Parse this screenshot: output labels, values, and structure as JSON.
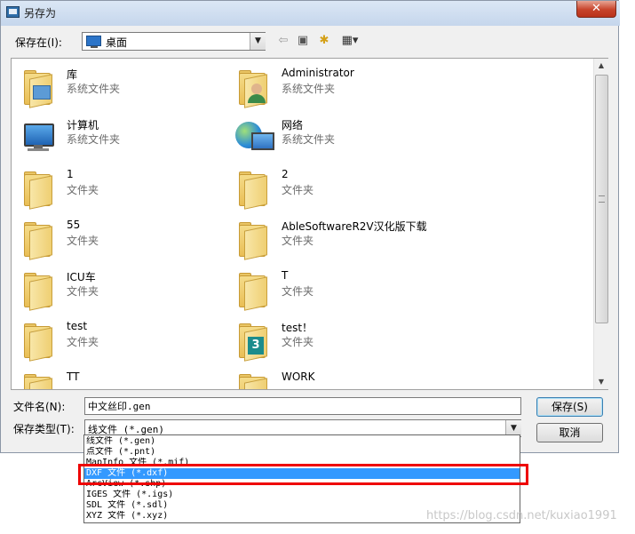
{
  "window": {
    "title": "另存为",
    "close_label": "✕"
  },
  "savein": {
    "label": "保存在(I):",
    "value": "桌面"
  },
  "toolbar": {
    "back": "⇦",
    "up": "▣",
    "new_folder": "✱",
    "view": "▦▾"
  },
  "files": [
    {
      "name": "库",
      "sub": "系统文件夹",
      "icon": "library-icon"
    },
    {
      "name": "Administrator",
      "sub": "系统文件夹",
      "icon": "user-folder-icon"
    },
    {
      "name": "计算机",
      "sub": "系统文件夹",
      "icon": "computer-icon"
    },
    {
      "name": "网络",
      "sub": "系统文件夹",
      "icon": "network-icon"
    },
    {
      "name": "1",
      "sub": "文件夹",
      "icon": "folder-icon"
    },
    {
      "name": "2",
      "sub": "文件夹",
      "icon": "folder-icon"
    },
    {
      "name": "55",
      "sub": "文件夹",
      "icon": "folder-icon"
    },
    {
      "name": "AbleSoftwareR2V汉化版下载",
      "sub": "文件夹",
      "icon": "folder-icon"
    },
    {
      "name": "ICU车",
      "sub": "文件夹",
      "icon": "folder-icon"
    },
    {
      "name": "T",
      "sub": "文件夹",
      "icon": "folder-icon"
    },
    {
      "name": "test",
      "sub": "文件夹",
      "icon": "folder-icon"
    },
    {
      "name": "test！",
      "sub": "文件夹",
      "icon": "folder-3dsmax-icon"
    },
    {
      "name": "TT",
      "sub": "",
      "icon": "folder-icon"
    },
    {
      "name": "WORK",
      "sub": "",
      "icon": "folder-icon"
    }
  ],
  "filename": {
    "label": "文件名(N):",
    "value": "中文丝印.gen"
  },
  "filetype": {
    "label": "保存类型(T):",
    "value": "线文件 (*.gen)",
    "options": [
      "线文件 (*.gen)",
      "点文件 (*.pnt)",
      "MapInfo 文件 (*.mif)",
      "DXF 文件 (*.dxf)",
      "ArcView (*.shp)",
      "IGES 文件 (*.igs)",
      "SDL 文件 (*.sdl)",
      "XYZ 文件 (*.xyz)"
    ],
    "selected_index": 3
  },
  "buttons": {
    "save": "保存(S)",
    "cancel": "取消"
  },
  "watermark": "https://blog.csdn.net/kuxiao1991",
  "colors": {
    "selection": "#3399ff",
    "highlight_box": "#ee0000"
  }
}
